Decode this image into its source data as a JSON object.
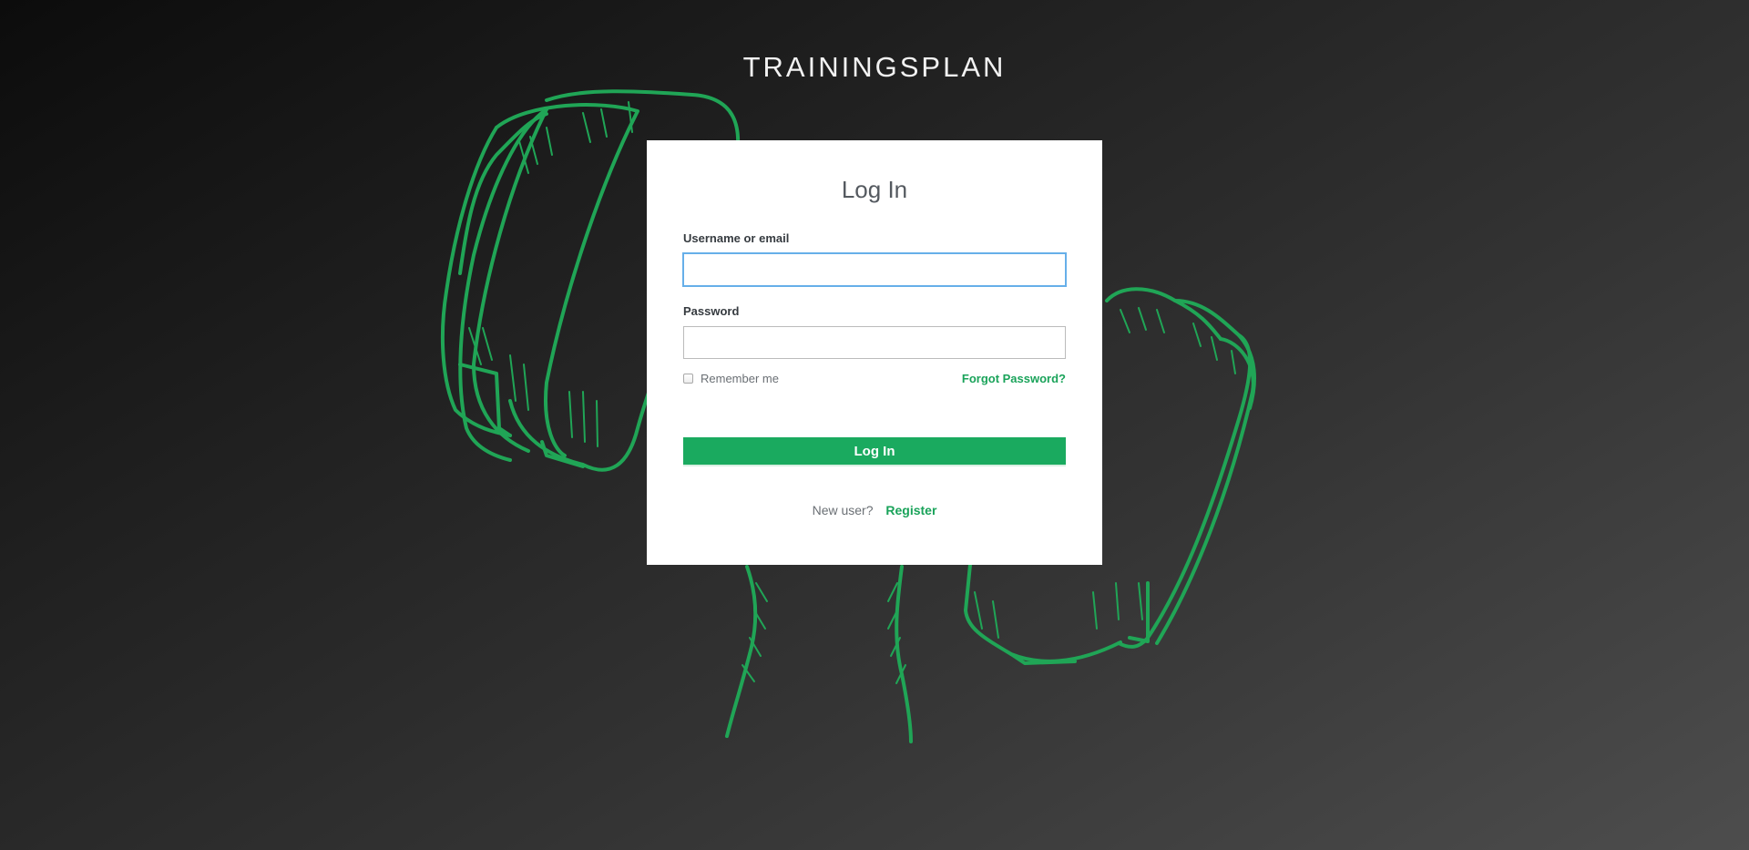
{
  "app": {
    "title": "TRAININGSPLAN"
  },
  "login": {
    "heading": "Log In",
    "username_label": "Username or email",
    "username_value": "",
    "password_label": "Password",
    "password_value": "",
    "remember_label": "Remember me",
    "remember_checked": false,
    "forgot_label": "Forgot Password?",
    "submit_label": "Log In",
    "new_user_text": "New user?",
    "register_label": "Register"
  },
  "colors": {
    "accent": "#1aaa5f",
    "illustration": "#1fa354",
    "focus": "#66afe9"
  },
  "icons": {
    "background": "dumbbell-illustration"
  }
}
